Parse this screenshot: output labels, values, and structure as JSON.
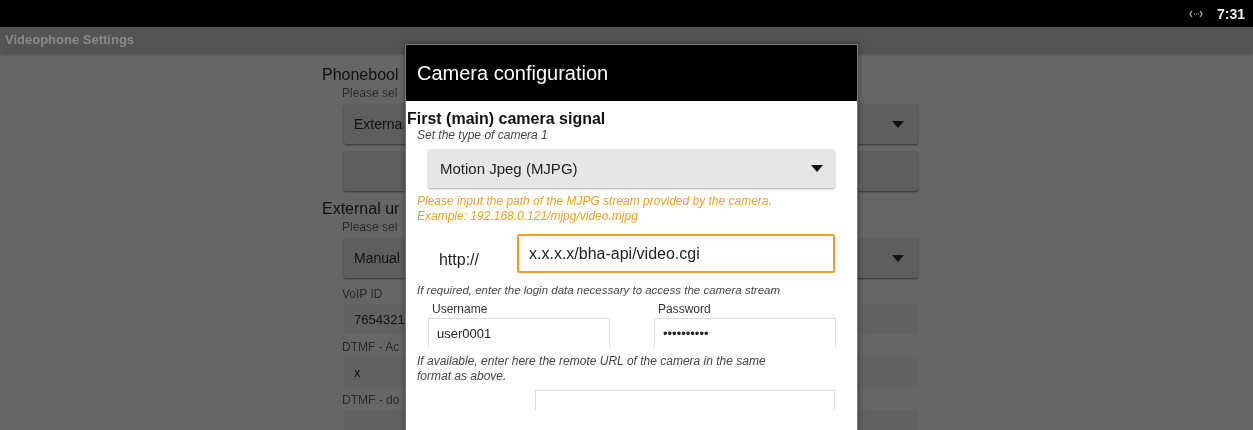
{
  "status_bar": {
    "time": "7:31"
  },
  "app_bar": {
    "title": "Videophone Settings"
  },
  "background": [
    {
      "kind": "heading",
      "text": "Phonebool"
    },
    {
      "kind": "hint",
      "text": "Please sel"
    },
    {
      "kind": "dropdown",
      "value": "Externa"
    },
    {
      "kind": "button"
    },
    {
      "kind": "heading",
      "text": "External ur"
    },
    {
      "kind": "hint",
      "text": "Please sel"
    },
    {
      "kind": "dropdown",
      "value": "Manual"
    },
    {
      "kind": "label",
      "text": "VoIP ID"
    },
    {
      "kind": "field",
      "value": "7654321"
    },
    {
      "kind": "label",
      "text": "DTMF - Ac"
    },
    {
      "kind": "field",
      "value": "x"
    },
    {
      "kind": "label",
      "text": "DTMF - do"
    },
    {
      "kind": "field"
    }
  ],
  "dialog": {
    "title": "Camera configuration",
    "section_title": "First (main) camera signal",
    "type_label": "Set the type of camera 1",
    "type_value": "Motion Jpeg (MJPG)",
    "path_hint": "Please input the path of the MJPG stream provided by the camera. Example: 192.168.0.121/mjpg/video.mjpg",
    "url_prefix": "http://",
    "url_value": "x.x.x.x/bha-api/video.cgi",
    "login_hint": "If required, enter the login data necessary to access the camera stream",
    "username": {
      "label": "Username",
      "value": "user0001"
    },
    "password": {
      "label": "Password",
      "value": "••••••••••"
    },
    "remote_hint": "If available, enter here the remote URL of the camera in the same format as above."
  }
}
